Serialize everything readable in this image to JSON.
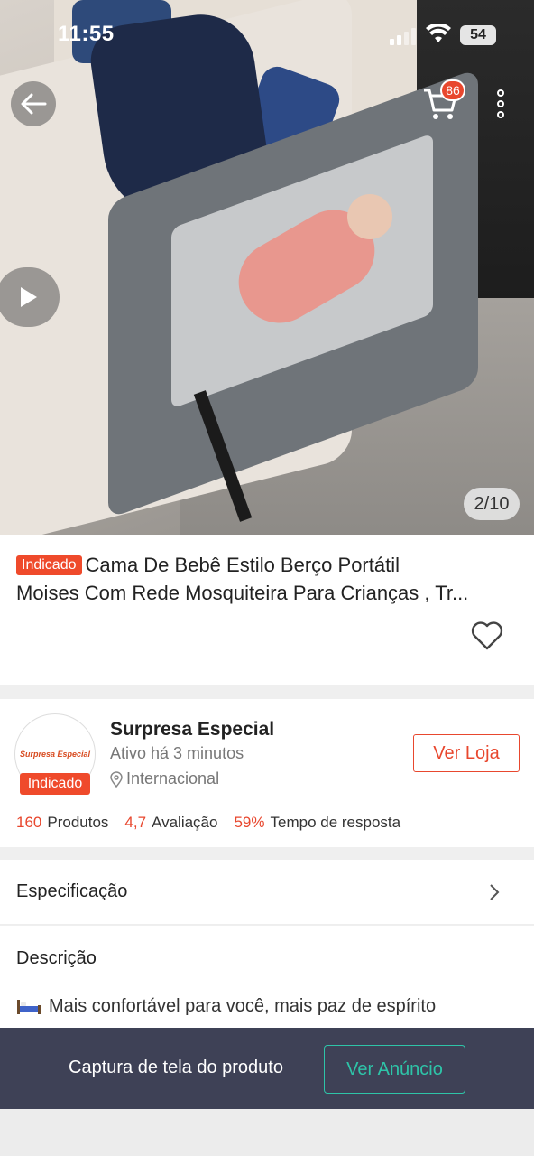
{
  "status_bar": {
    "time": "11:55",
    "battery": "54"
  },
  "hero": {
    "cart_count": "86",
    "image_counter": "2/10"
  },
  "product": {
    "tag": "Indicado",
    "title_line1": "Cama De Bebê Estilo Berço Portátil",
    "title_line2": "Moises Com Rede Mosquiteira Para Crianças , Tr..."
  },
  "seller": {
    "logo_text": "Surpresa Especial",
    "tag": "Indicado",
    "name": "Surpresa Especial",
    "active": "Ativo há 3 minutos",
    "location": "Internacional",
    "visit_button": "Ver Loja",
    "stats": [
      {
        "value": "160",
        "label": "Produtos"
      },
      {
        "value": "4,7",
        "label": "Avaliação"
      },
      {
        "value": "59%",
        "label": "Tempo de resposta"
      }
    ]
  },
  "specification": {
    "label": "Especificação"
  },
  "description": {
    "title": "Descrição",
    "line1": "Mais confortável para você, mais paz de espírito"
  },
  "banner": {
    "text": "Captura de tela do produto",
    "button": "Ver Anúncio"
  },
  "colors": {
    "accent": "#e8472e",
    "banner_bg": "#3e4156",
    "banner_button": "#2ec4a8"
  }
}
